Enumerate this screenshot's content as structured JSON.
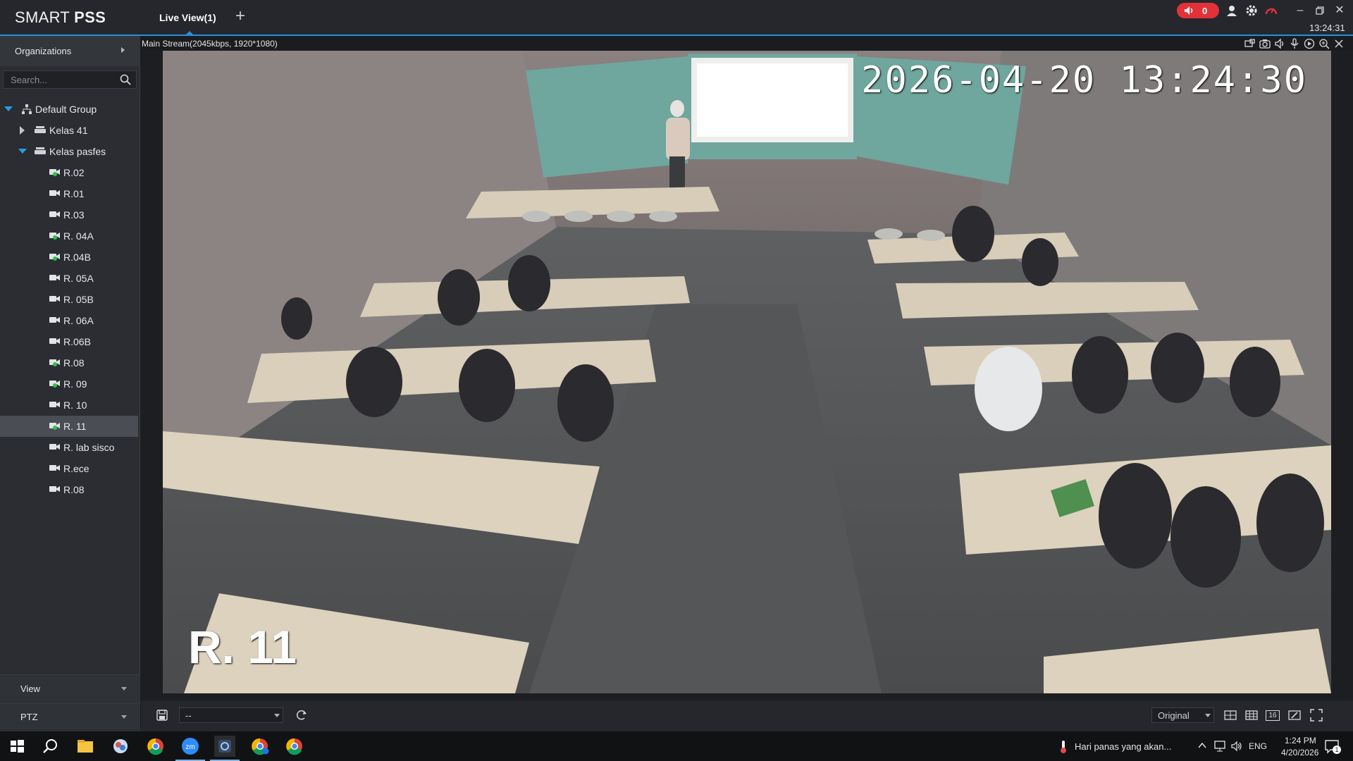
{
  "app": {
    "title_prefix": "SMART",
    "title_bold": "PSS",
    "tab_label": "Live View(1)",
    "add_tab": "+",
    "alarm_count": "0",
    "clock": "13:24:31",
    "accent": "#2a8fdb",
    "alarm_color": "#e3313a"
  },
  "sidebar": {
    "header": "Organizations",
    "search_placeholder": "Search...",
    "root": "Default Group",
    "groups": [
      {
        "label": "Kelas 41",
        "expanded": false
      },
      {
        "label": "Kelas pasfes",
        "expanded": true
      }
    ],
    "cameras": [
      "R.02",
      "R.01",
      "R.03",
      "R. 04A",
      "R.04B",
      "R. 05A",
      "R. 05B",
      "R. 06A",
      "R.06B",
      "R.08",
      "R. 09",
      "R. 10",
      "R. 11",
      "R. lab sisco",
      "R.ece",
      "R.08"
    ],
    "selected_camera": "R. 11",
    "footer": [
      {
        "label": "View"
      },
      {
        "label": "PTZ"
      }
    ]
  },
  "stream": {
    "info": "Main Stream(2045kbps, 1920*1080)",
    "osd_timestamp": "2026-04-20 13:24:30",
    "osd_name": "R. 11"
  },
  "controls": {
    "preset_value": "--",
    "ratio_value": "Original",
    "layout_16": "16"
  },
  "taskbar": {
    "notification": "Hari panas yang akan...",
    "language": "ENG",
    "time": "1:24 PM",
    "date": "4/20/2026",
    "badge": "1"
  }
}
